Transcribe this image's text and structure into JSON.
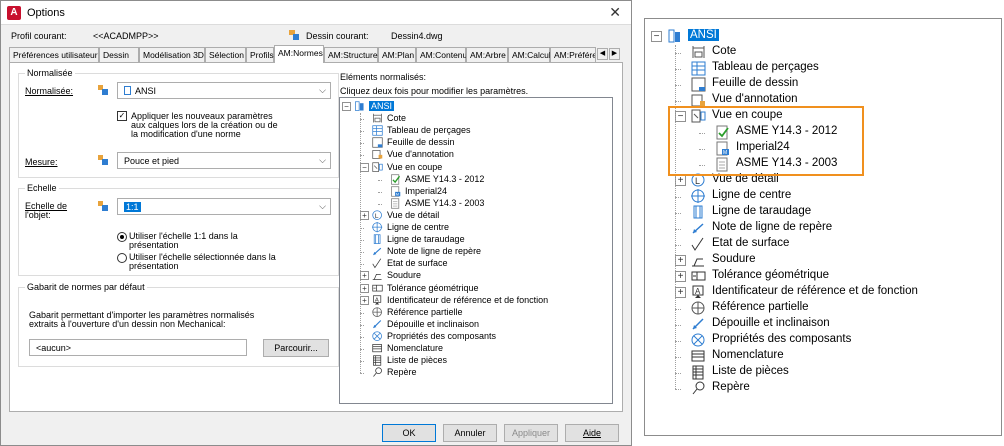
{
  "window": {
    "title": "Options",
    "app_icon_letter": "A",
    "close_glyph": "✕"
  },
  "profile": {
    "label": "Profil courant:",
    "value": "<<ACADMPP>>",
    "drawing_label": "Dessin courant:",
    "drawing_value": "Dessin4.dwg"
  },
  "tabs": [
    "Préférences utilisateur",
    "Dessin",
    "Modélisation 3D",
    "Sélection",
    "Profils",
    "AM:Normes",
    "AM:Structure",
    "AM:Plan",
    "AM:Contenu",
    "AM:Arbre",
    "AM:Calcul",
    "AM:Préféren"
  ],
  "active_tab": "AM:Normes",
  "normalisee_group": {
    "title": "Normalisée",
    "norm_label": "Normalisée:",
    "norm_value": "ANSI",
    "checkbox_label_1": "Appliquer les nouveaux paramètres",
    "checkbox_label_2": "aux calques lors de la création ou de",
    "checkbox_label_3": "la modification d'une norme",
    "checkbox_checked": true,
    "mesure_label": "Mesure:",
    "mesure_value": "Pouce et pied"
  },
  "echelle_group": {
    "title": "Echelle",
    "label_1": "Echelle de",
    "label_2": "l'objet:",
    "value": "1:1",
    "radio1_l1": "Utiliser l'échelle 1:1 dans la",
    "radio1_l2": "présentation",
    "radio2_l1": "Utiliser l'échelle sélectionnée dans la",
    "radio2_l2": "présentation",
    "selected_radio": 1
  },
  "gabarit_group": {
    "title": "Gabarit de normes par défaut",
    "desc_1": "Gabarit permettant d'importer les paramètres normalisés",
    "desc_2": "extraits à l'ouverture d'un dessin non Mechanical:",
    "value": "<aucun>",
    "browse_label": "Parcourir..."
  },
  "elements": {
    "title": "Eléments normalisés:",
    "hint": "Cliquez deux fois pour modifier les paramètres.",
    "root": "ANSI",
    "items": [
      {
        "label": "Cote",
        "icon": "dimension-icon",
        "level": 1,
        "expander": ""
      },
      {
        "label": "Tableau de perçages",
        "icon": "hole-table-icon",
        "level": 1,
        "expander": ""
      },
      {
        "label": "Feuille de dessin",
        "icon": "drawing-sheet-icon",
        "level": 1,
        "expander": ""
      },
      {
        "label": "Vue d'annotation",
        "icon": "annotation-view-icon",
        "level": 1,
        "expander": ""
      },
      {
        "label": "Vue en coupe",
        "icon": "section-view-icon",
        "level": 1,
        "expander": "−"
      },
      {
        "label": "ASME Y14.3 - 2012",
        "icon": "asme-checked-icon",
        "level": 2,
        "expander": ""
      },
      {
        "label": "Imperial24",
        "icon": "imperial-icon",
        "level": 2,
        "expander": ""
      },
      {
        "label": "ASME Y14.3 - 2003",
        "icon": "asme-doc-icon",
        "level": 2,
        "expander": ""
      },
      {
        "label": "Vue de détail",
        "icon": "detail-view-icon",
        "level": 1,
        "expander": "+"
      },
      {
        "label": "Ligne de centre",
        "icon": "centerline-icon",
        "level": 1,
        "expander": ""
      },
      {
        "label": "Ligne de taraudage",
        "icon": "thread-line-icon",
        "level": 1,
        "expander": ""
      },
      {
        "label": "Note de ligne de repère",
        "icon": "leader-note-icon",
        "level": 1,
        "expander": ""
      },
      {
        "label": "Etat de surface",
        "icon": "surface-texture-icon",
        "level": 1,
        "expander": ""
      },
      {
        "label": "Soudure",
        "icon": "weld-icon",
        "level": 1,
        "expander": "+"
      },
      {
        "label": "Tolérance géométrique",
        "icon": "geometric-tolerance-icon",
        "level": 1,
        "expander": "+"
      },
      {
        "label": "Identificateur de référence et de fonction",
        "icon": "datum-identifier-icon",
        "level": 1,
        "expander": "+"
      },
      {
        "label": "Référence partielle",
        "icon": "datum-target-icon",
        "level": 1,
        "expander": ""
      },
      {
        "label": "Dépouille et inclinaison",
        "icon": "taper-slope-icon",
        "level": 1,
        "expander": ""
      },
      {
        "label": "Propriétés des composants",
        "icon": "component-properties-icon",
        "level": 1,
        "expander": ""
      },
      {
        "label": "Nomenclature",
        "icon": "bom-icon",
        "level": 1,
        "expander": ""
      },
      {
        "label": "Liste de pièces",
        "icon": "parts-list-icon",
        "level": 1,
        "expander": ""
      },
      {
        "label": "Repère",
        "icon": "balloon-icon",
        "level": 1,
        "expander": ""
      }
    ]
  },
  "buttons": {
    "ok": "OK",
    "cancel": "Annuler",
    "apply": "Appliquer",
    "help": "Aide"
  },
  "colors": {
    "accent": "#0078d7",
    "highlight": "#f0901e",
    "dialog_bg": "#f0f0f0"
  }
}
